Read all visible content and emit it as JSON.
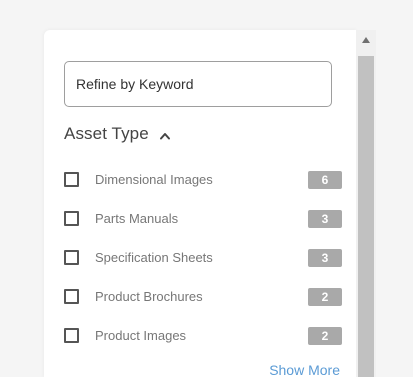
{
  "search": {
    "placeholder": "Refine by Keyword",
    "value": ""
  },
  "facet": {
    "title": "Asset Type",
    "expanded": true,
    "items": [
      {
        "label": "Dimensional Images",
        "count": "6",
        "checked": false
      },
      {
        "label": "Parts Manuals",
        "count": "3",
        "checked": false
      },
      {
        "label": "Specification Sheets",
        "count": "3",
        "checked": false
      },
      {
        "label": "Product Brochures",
        "count": "2",
        "checked": false
      },
      {
        "label": "Product Images",
        "count": "2",
        "checked": false
      }
    ],
    "show_more_label": "Show More"
  },
  "icons": {
    "collapse": "chevron-up-icon",
    "scroll_up": "triangle-up-icon"
  },
  "colors": {
    "link": "#5b9bd5",
    "badge": "#a9a9a9",
    "scroll_thumb": "#c1c1c1"
  }
}
